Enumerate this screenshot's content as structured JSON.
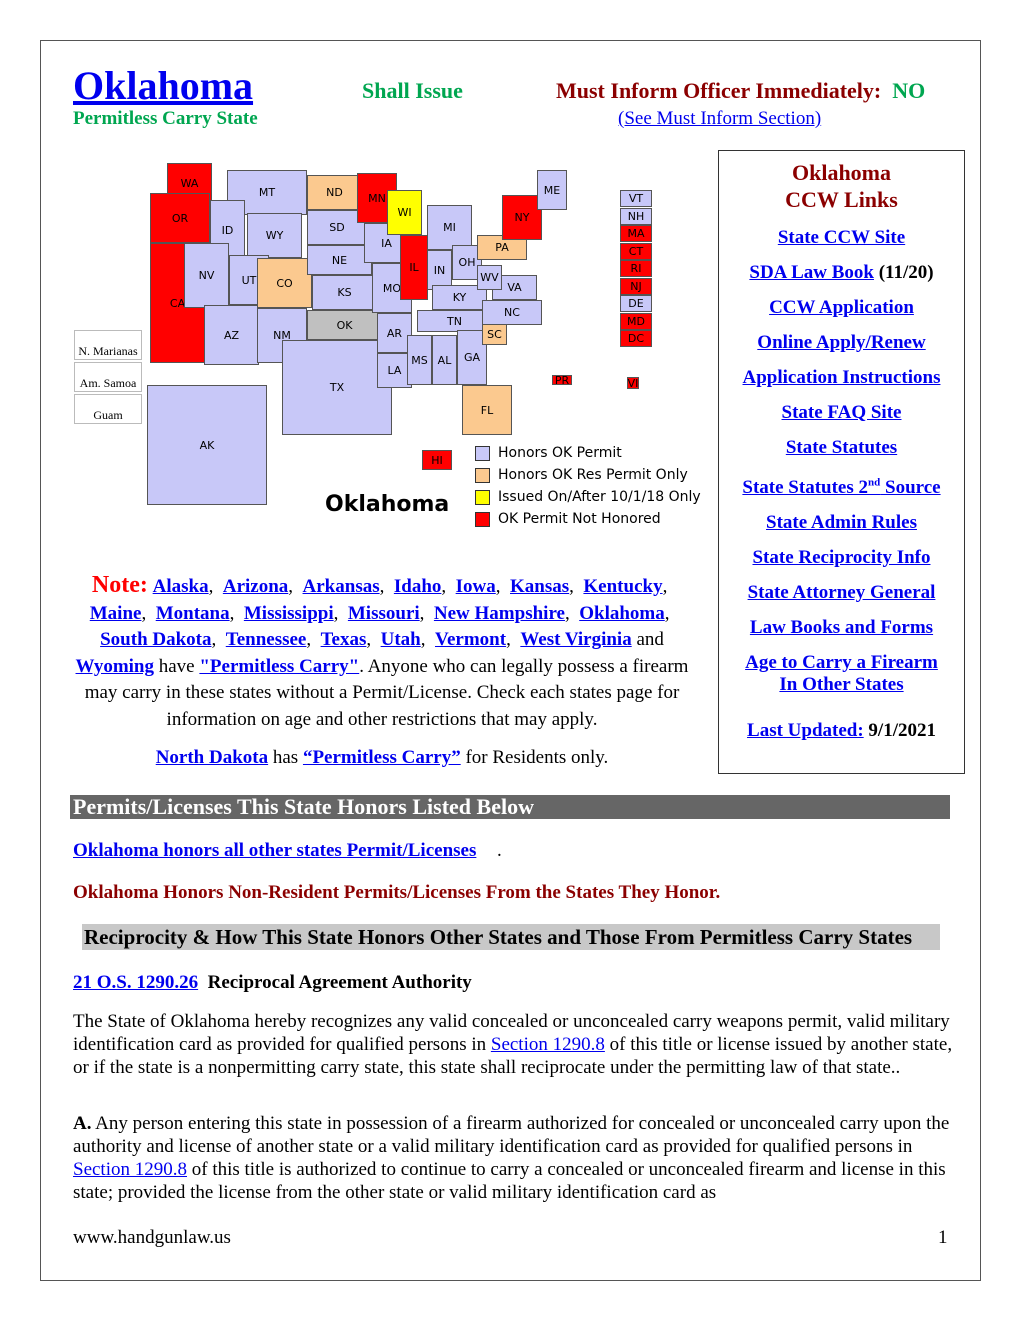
{
  "header": {
    "state": "Oklahoma",
    "permit_type": "Shall Issue",
    "permitless": "Permitless Carry State",
    "must_inform_label": "Must Inform Officer Immediately:",
    "must_inform_value": "NO",
    "must_inform_link": "(See Must Inform Section)"
  },
  "map": {
    "title": "Oklahoma",
    "colors": {
      "honors": "#c8c8f8",
      "res_only": "#fbc98f",
      "issued_after": "#ffff00",
      "not_honored": "#ff0000",
      "home": "#c0c0c0"
    },
    "states": [
      {
        "label": "WA",
        "c": "not_honored"
      },
      {
        "label": "OR",
        "c": "not_honored"
      },
      {
        "label": "CA",
        "c": "not_honored"
      },
      {
        "label": "MT",
        "c": "honors"
      },
      {
        "label": "ID",
        "c": "honors"
      },
      {
        "label": "NV",
        "c": "honors"
      },
      {
        "label": "WY",
        "c": "honors"
      },
      {
        "label": "UT",
        "c": "honors"
      },
      {
        "label": "AZ",
        "c": "honors"
      },
      {
        "label": "CO",
        "c": "res_only"
      },
      {
        "label": "NM",
        "c": "honors"
      },
      {
        "label": "ND",
        "c": "res_only"
      },
      {
        "label": "SD",
        "c": "honors"
      },
      {
        "label": "NE",
        "c": "honors"
      },
      {
        "label": "KS",
        "c": "honors"
      },
      {
        "label": "OK",
        "c": "home"
      },
      {
        "label": "TX",
        "c": "honors"
      },
      {
        "label": "MN",
        "c": "not_honored"
      },
      {
        "label": "IA",
        "c": "honors"
      },
      {
        "label": "MO",
        "c": "honors"
      },
      {
        "label": "AR",
        "c": "honors"
      },
      {
        "label": "LA",
        "c": "honors"
      },
      {
        "label": "WI",
        "c": "issued_after"
      },
      {
        "label": "IL",
        "c": "not_honored"
      },
      {
        "label": "MI",
        "c": "honors"
      },
      {
        "label": "IN",
        "c": "honors"
      },
      {
        "label": "OH",
        "c": "honors"
      },
      {
        "label": "KY",
        "c": "honors"
      },
      {
        "label": "TN",
        "c": "honors"
      },
      {
        "label": "MS",
        "c": "honors"
      },
      {
        "label": "AL",
        "c": "honors"
      },
      {
        "label": "GA",
        "c": "honors"
      },
      {
        "label": "FL",
        "c": "res_only"
      },
      {
        "label": "SC",
        "c": "res_only"
      },
      {
        "label": "NC",
        "c": "honors"
      },
      {
        "label": "VA",
        "c": "honors"
      },
      {
        "label": "WV",
        "c": "honors"
      },
      {
        "label": "PA",
        "c": "res_only"
      },
      {
        "label": "NY",
        "c": "not_honored"
      },
      {
        "label": "ME",
        "c": "honors"
      },
      {
        "label": "AK",
        "c": "honors"
      },
      {
        "label": "HI",
        "c": "not_honored"
      },
      {
        "label": "PR",
        "c": "not_honored"
      },
      {
        "label": "VI",
        "c": "not_honored"
      }
    ],
    "ne_states": [
      {
        "label": "VT",
        "c": "honors"
      },
      {
        "label": "NH",
        "c": "honors"
      },
      {
        "label": "MA",
        "c": "not_honored"
      },
      {
        "label": "CT",
        "c": "not_honored"
      },
      {
        "label": "RI",
        "c": "not_honored"
      },
      {
        "label": "NJ",
        "c": "not_honored"
      },
      {
        "label": "DE",
        "c": "honors"
      },
      {
        "label": "MD",
        "c": "not_honored"
      },
      {
        "label": "DC",
        "c": "not_honored"
      }
    ],
    "territories": [
      "N. Marianas",
      "Am. Samoa",
      "Guam"
    ],
    "legend": [
      {
        "label": "Honors OK Permit",
        "c": "honors"
      },
      {
        "label": "Honors OK Res Permit Only",
        "c": "res_only"
      },
      {
        "label": "Issued On/After 10/1/18 Only",
        "c": "issued_after"
      },
      {
        "label": "OK Permit Not Honored",
        "c": "not_honored"
      }
    ]
  },
  "links": {
    "title1": "Oklahoma",
    "title2": "CCW  Links",
    "items": [
      "State CCW Site",
      "SDA Law Book",
      "CCW Application",
      "Online Apply/Renew",
      "Application Instructions",
      "State FAQ Site",
      "State Statutes",
      "State Statutes 2",
      "State Admin Rules",
      "State Reciprocity Info",
      "State Attorney General",
      "Law Books and Forms",
      "Age to Carry a Firearm",
      "In Other States",
      "Last Updated:"
    ],
    "sda_date": "(11/20)",
    "nd_sup": "nd",
    "source": " Source",
    "updated": "9/1/2021"
  },
  "note": {
    "label": "Note:",
    "states": [
      "Alaska",
      "Arizona",
      "Arkansas",
      "Idaho",
      "Iowa",
      "Kansas",
      "Kentucky",
      "Maine",
      "Montana",
      "Mississippi",
      "Missouri",
      "New Hampshire",
      "Oklahoma",
      "South Dakota",
      "Tennessee",
      "Texas",
      "Utah",
      "Vermont",
      "West Virginia",
      "Wyoming"
    ],
    "and": "and",
    "have": "have",
    "permitless": "\"Permitless Carry\"",
    "text": ". Anyone who can legally possess a firearm may carry in these states without a Permit/License. Check each states  page for  information on age and other  restrictions that may apply.",
    "nd": "North Dakota",
    "nd_has": "has",
    "nd_permitless": "“Permitless Carry”",
    "nd_tail": "for Residents only."
  },
  "section": {
    "bar": "Permits/Licenses This State Honors  Listed Below",
    "honors_link": "Oklahoma honors all other states Permit/Licenses",
    "nonres": "Oklahoma Honors Non-Resident Permits/Licenses  From the States They Honor.",
    "recip_bar": "Reciprocity & How This State Honors Other States and Those From Permitless Carry States",
    "statute_link": "21 O.S. 1290.26",
    "statute_title": "Reciprocal Agreement Authority",
    "p1a": "The State of Oklahoma hereby recognizes any valid concealed or unconcealed carry weapons permit, valid military identification card as provided for qualified persons in ",
    "sec_link": "Section 1290.8",
    "p1b": " of this title or license issued by another state, or if the state is a nonpermitting carry state, this state shall reciprocate under the permitting law of that state..",
    "pa_label": "A.",
    "p2a": " Any person entering this state in possession of a firearm authorized for concealed or unconcealed carry upon the authority and license of another state or a valid military identification card as provided for qualified persons in ",
    "p2b": " of this title is authorized to continue to carry a concealed or unconcealed firearm and license in this state; provided the license from the other state or valid military identification card as"
  },
  "footer": {
    "site": "www.handgunlaw.us",
    "page": "1"
  }
}
